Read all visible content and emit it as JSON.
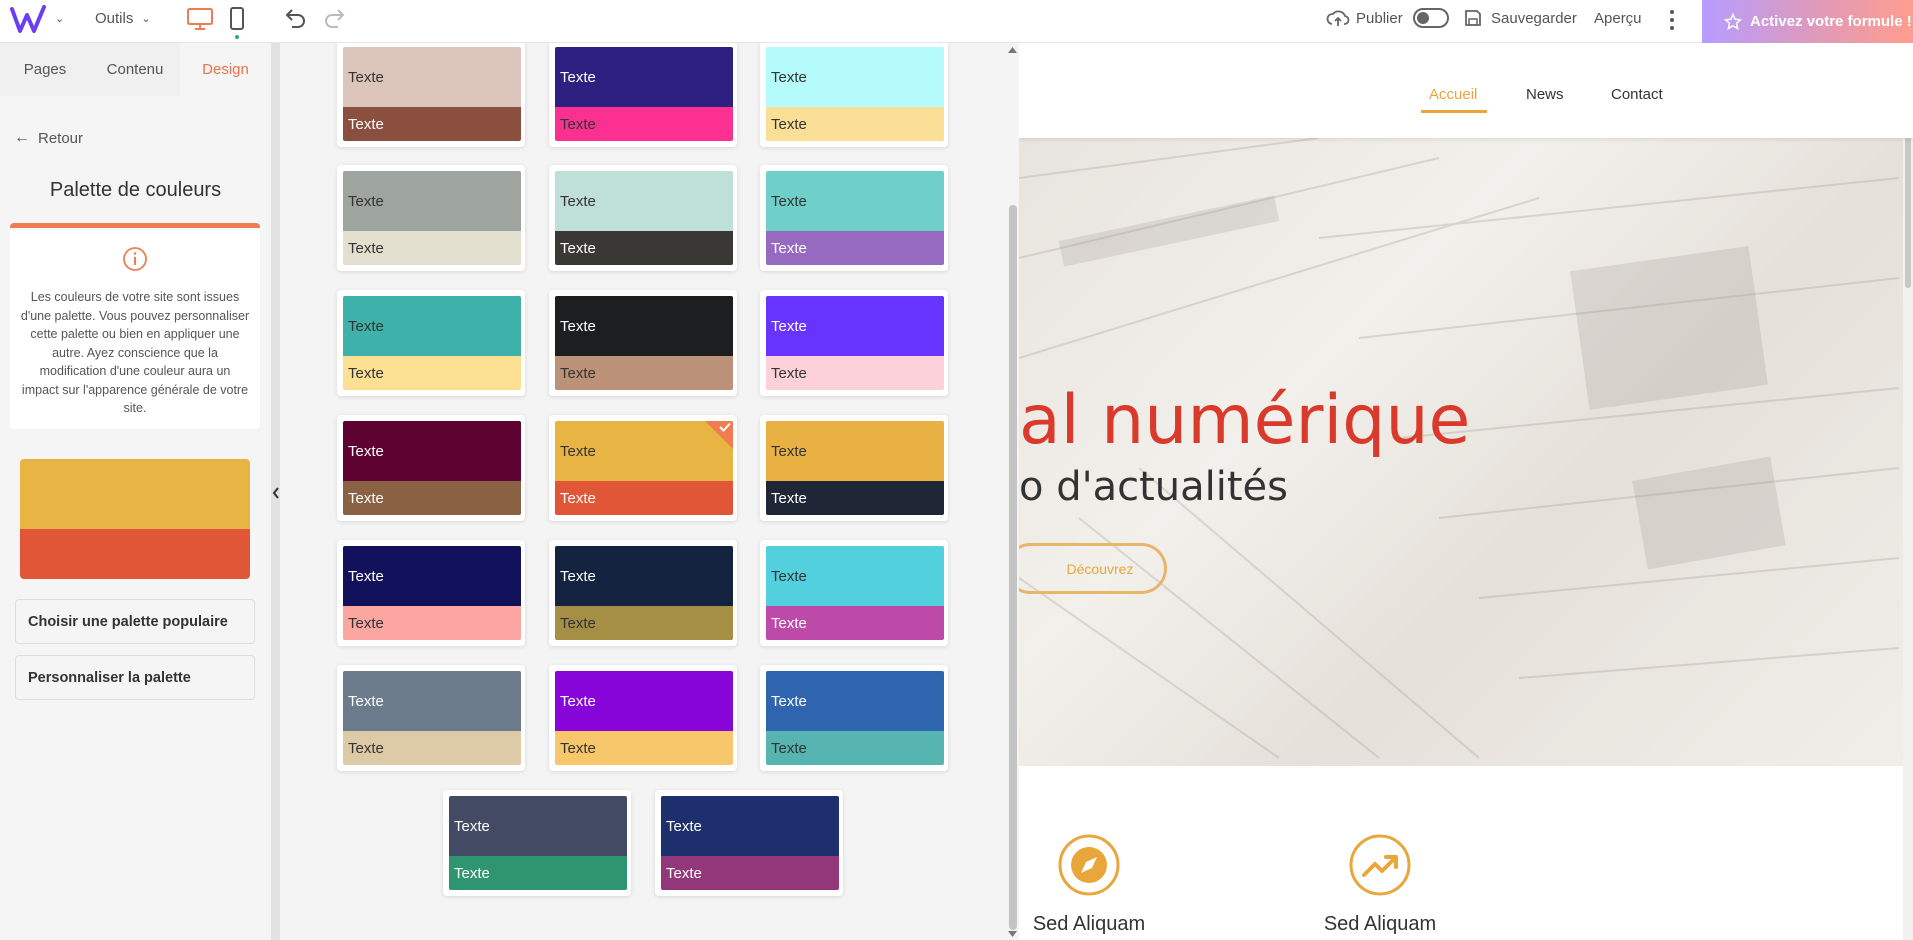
{
  "topbar": {
    "tools_label": "Outils",
    "publish_label": "Publier",
    "save_label": "Sauvegarder",
    "preview_label": "Aperçu",
    "activate_label": "Activez votre formule !"
  },
  "sidebar": {
    "tabs": [
      {
        "label": "Pages"
      },
      {
        "label": "Contenu"
      },
      {
        "label": "Design"
      }
    ],
    "back_label": "Retour",
    "title": "Palette de couleurs",
    "info_text": "Les couleurs de votre site sont issues d'une palette. Vous pouvez personnaliser cette palette ou bien en appliquer une autre. Ayez conscience que la modification d'une couleur aura un impact sur l'apparence générale de votre site.",
    "current_palette": {
      "top": "#e8b444",
      "bottom": "#e05636"
    },
    "choose_popular_label": "Choisir une palette populaire",
    "customize_label": "Personnaliser la palette"
  },
  "palettes": [
    {
      "top": "#dcc5bb",
      "top_text": "#333333",
      "bottom": "#8b4f3f",
      "bottom_text": "#ffffff",
      "label_top": "Texte",
      "label_bottom": "Texte"
    },
    {
      "top": "#2e2081",
      "top_text": "#ffffff",
      "bottom": "#fb3090",
      "bottom_text": "#333333",
      "label_top": "Texte",
      "label_bottom": "Texte"
    },
    {
      "top": "#b5fbfc",
      "top_text": "#333333",
      "bottom": "#fcdf97",
      "bottom_text": "#333333",
      "label_top": "Texte",
      "label_bottom": "Texte"
    },
    {
      "top": "#9ea59f",
      "top_text": "#333333",
      "bottom": "#e4e0cf",
      "bottom_text": "#333333",
      "label_top": "Texte",
      "label_bottom": "Texte"
    },
    {
      "top": "#bfe0d8",
      "top_text": "#333333",
      "bottom": "#3a3835",
      "bottom_text": "#ffffff",
      "label_top": "Texte",
      "label_bottom": "Texte"
    },
    {
      "top": "#6fd0ca",
      "top_text": "#333333",
      "bottom": "#966ac1",
      "bottom_text": "#ffffff",
      "label_top": "Texte",
      "label_bottom": "Texte"
    },
    {
      "top": "#3eb1ab",
      "top_text": "#333333",
      "bottom": "#fce093",
      "bottom_text": "#333333",
      "label_top": "Texte",
      "label_bottom": "Texte"
    },
    {
      "top": "#1d1e1f",
      "top_text": "#ffffff",
      "bottom": "#bb9177",
      "bottom_text": "#333333",
      "label_top": "Texte",
      "label_bottom": "Texte"
    },
    {
      "top": "#6633ff",
      "top_text": "#ffffff",
      "bottom": "#fdd1d9",
      "bottom_text": "#333333",
      "label_top": "Texte",
      "label_bottom": "Texte"
    },
    {
      "top": "#5e0331",
      "top_text": "#ffffff",
      "bottom": "#8a6142",
      "bottom_text": "#ffffff",
      "label_top": "Texte",
      "label_bottom": "Texte"
    },
    {
      "top": "#e8b444",
      "top_text": "#333333",
      "bottom": "#e05636",
      "bottom_text": "#ffffff",
      "label_top": "Texte",
      "label_bottom": "Texte",
      "selected": true
    },
    {
      "top": "#e9b043",
      "top_text": "#333333",
      "bottom": "#1f2737",
      "bottom_text": "#ffffff",
      "label_top": "Texte",
      "label_bottom": "Texte"
    },
    {
      "top": "#11125b",
      "top_text": "#ffffff",
      "bottom": "#fca6a1",
      "bottom_text": "#333333",
      "label_top": "Texte",
      "label_bottom": "Texte"
    },
    {
      "top": "#14233f",
      "top_text": "#ffffff",
      "bottom": "#a58f45",
      "bottom_text": "#333333",
      "label_top": "Texte",
      "label_bottom": "Texte"
    },
    {
      "top": "#53d0de",
      "top_text": "#333333",
      "bottom": "#bd4aa8",
      "bottom_text": "#ffffff",
      "label_top": "Texte",
      "label_bottom": "Texte"
    },
    {
      "top": "#6b7b8c",
      "top_text": "#ffffff",
      "bottom": "#ddcba8",
      "bottom_text": "#333333",
      "label_top": "Texte",
      "label_bottom": "Texte"
    },
    {
      "top": "#8805da",
      "top_text": "#ffffff",
      "bottom": "#f8c76c",
      "bottom_text": "#333333",
      "label_top": "Texte",
      "label_bottom": "Texte"
    },
    {
      "top": "#2f64ae",
      "top_text": "#ffffff",
      "bottom": "#56b5b1",
      "bottom_text": "#333333",
      "label_top": "Texte",
      "label_bottom": "Texte"
    },
    {
      "top": "#434b64",
      "top_text": "#ffffff",
      "bottom": "#2e9570",
      "bottom_text": "#ffffff",
      "label_top": "Texte",
      "label_bottom": "Texte"
    },
    {
      "top": "#1d2f6c",
      "top_text": "#ffffff",
      "bottom": "#92387a",
      "bottom_text": "#ffffff",
      "label_top": "Texte",
      "label_bottom": "Texte"
    }
  ],
  "site": {
    "nav": [
      {
        "label": "Accueil"
      },
      {
        "label": "News"
      },
      {
        "label": "Contact"
      }
    ],
    "hero_title": "al numérique",
    "hero_subtitle": "o d'actualités",
    "hero_button": "Découvrez",
    "features": [
      {
        "label": "Sed Aliquam",
        "icon": "compass-icon"
      },
      {
        "label": "Sed Aliquam",
        "icon": "trending-up-icon"
      }
    ],
    "accent_color": "#e8a63b",
    "hero_title_color": "#d93a2b"
  }
}
